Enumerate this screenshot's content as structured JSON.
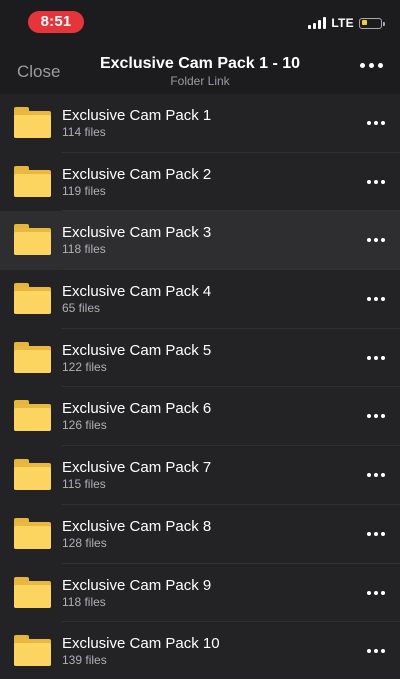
{
  "status_bar": {
    "time": "8:51",
    "network": "LTE",
    "battery_level": 0.3,
    "battery_color": "#f4cd2a",
    "time_pill_color": "#e5343a"
  },
  "nav": {
    "close_label": "Close",
    "title": "Exclusive Cam Pack 1 - 10",
    "subtitle": "Folder Link",
    "more_icon": "ellipsis-icon"
  },
  "folders": [
    {
      "name": "Exclusive Cam Pack 1",
      "count": "114 files"
    },
    {
      "name": "Exclusive Cam Pack 2",
      "count": "119 files"
    },
    {
      "name": "Exclusive Cam Pack 3",
      "count": "118 files",
      "highlighted": true
    },
    {
      "name": "Exclusive Cam Pack 4",
      "count": "65 files"
    },
    {
      "name": "Exclusive Cam Pack 5",
      "count": "122 files"
    },
    {
      "name": "Exclusive Cam Pack 6",
      "count": "126 files"
    },
    {
      "name": "Exclusive Cam Pack 7",
      "count": "115 files"
    },
    {
      "name": "Exclusive Cam Pack 8",
      "count": "128 files"
    },
    {
      "name": "Exclusive Cam Pack 9",
      "count": "118 files"
    },
    {
      "name": "Exclusive Cam Pack 10",
      "count": "139 files"
    }
  ]
}
